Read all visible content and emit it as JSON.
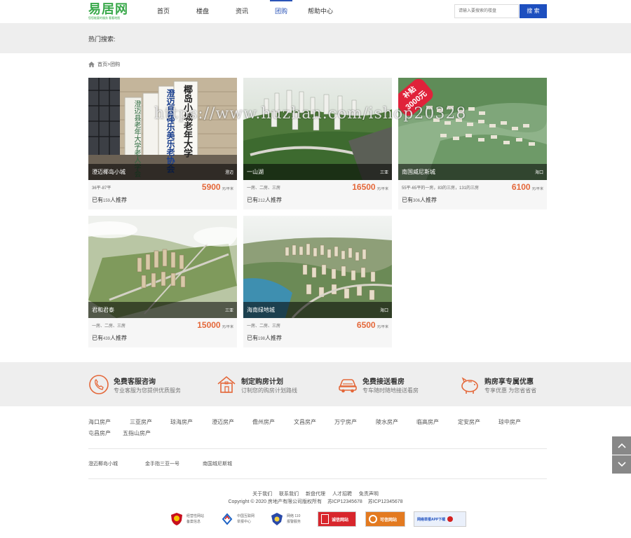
{
  "header": {
    "logo_name": "易居网",
    "logo_sub": "您您能要的服务 看看地图",
    "nav": [
      "首页",
      "楼盘",
      "资讯",
      "团购",
      "帮助中心"
    ],
    "search_placeholder": "请输入要搜索的楼盘",
    "search_button": "搜 索"
  },
  "hot_search": {
    "label": "热门搜索:"
  },
  "breadcrumb": {
    "text": "首页>团购"
  },
  "colors": {
    "accent": "#1d4fbf",
    "price": "#e4683a",
    "logo": "#3aa94b",
    "badge": "#e0223a"
  },
  "listings": [
    {
      "name": "澄迈椰岛小城",
      "area": "澄迈",
      "spec": "36平-87平",
      "price": "5900",
      "unit": "元/平米",
      "rec_pre": "已有",
      "rec_count": "159",
      "rec_post": "人推荐"
    },
    {
      "name": "一山湖",
      "area": "三亚",
      "spec": "一房、二房、三房",
      "price": "16500",
      "unit": "元/平米",
      "rec_pre": "已有",
      "rec_count": "212",
      "rec_post": "人推荐"
    },
    {
      "name": "南国威尼斯城",
      "area": "海口",
      "spec": "55平-65平的一房，83的三房，131的三房",
      "price": "6100",
      "unit": "元/平米",
      "rec_pre": "已有",
      "rec_count": "306",
      "rec_post": "人推荐",
      "badge_l1": "补贴",
      "badge_l2": "3000元"
    },
    {
      "name": "君和君泰",
      "area": "三亚",
      "spec": "一房、二房、三房",
      "price": "15000",
      "unit": "元/平米",
      "rec_pre": "已有",
      "rec_count": "439",
      "rec_post": "人推荐"
    },
    {
      "name": "海南绿地城",
      "area": "海口",
      "spec": "一房、二房、三房",
      "price": "6500",
      "unit": "元/平米",
      "rec_pre": "已有",
      "rec_count": "198",
      "rec_post": "人推荐"
    }
  ],
  "sign_texts": [
    "椰岛小城老年大学",
    "澄迈县椰乐美乐老协会",
    "澄迈县老年大学老人学会"
  ],
  "services": [
    {
      "title": "免费客服咨询",
      "desc": "专业客服为您提供优质服务",
      "icon": "phone-icon"
    },
    {
      "title": "制定购房计划",
      "desc": "订制您的购房计划路线",
      "icon": "house-icon"
    },
    {
      "title": "免费接送看房",
      "desc": "专车随时随地接送看房",
      "icon": "car-icon"
    },
    {
      "title": "购房享专属优惠",
      "desc": "专享优惠 为您省省省",
      "icon": "piggy-bank-icon"
    }
  ],
  "regions": [
    "海口房产",
    "三亚房产",
    "琼海房产",
    "澄迈房产",
    "儋州房产",
    "文昌房产",
    "万宁房产",
    "陵水房产",
    "临高房产",
    "定安房产",
    "琼中房产",
    "屯昌房产",
    "五指山房产"
  ],
  "projects": [
    "澄迈椰岛小城",
    "金手指三亚一号",
    "南国城尼斯城"
  ],
  "footer": {
    "links": [
      "关于我们",
      "联系我们",
      "新盘代理",
      "人才招聘",
      "免责声明"
    ],
    "copyright": "Copyright © 2020 房地产有限公司版权所有",
    "icp1": "苏ICP12345678",
    "icp2": "苏ICP12345678",
    "certs": [
      {
        "l1": "经营性网站",
        "l2": "备案信息"
      },
      {
        "l1": "中国互联网",
        "l2": "举报中心"
      },
      {
        "l1": "网络 110",
        "l2": "报警服务"
      }
    ],
    "cert_boxes": [
      "诚信网站",
      "可信网站",
      "网络举报APP下载"
    ]
  },
  "watermark": "https://www.huzhan.com/ishop20328"
}
